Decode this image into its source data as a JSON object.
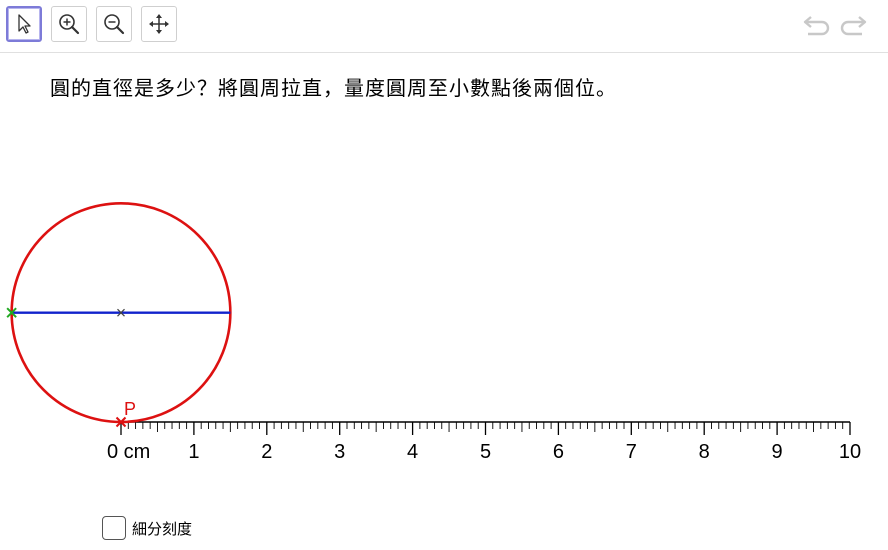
{
  "toolbar": {
    "tools": [
      {
        "name": "move-tool",
        "icon": "cursor-arrow-icon",
        "active": true
      },
      {
        "name": "zoom-in-tool",
        "icon": "zoom-in-icon",
        "active": false
      },
      {
        "name": "zoom-out-tool",
        "icon": "zoom-out-icon",
        "active": false
      },
      {
        "name": "move-graphics-view-tool",
        "icon": "move-arrows-icon",
        "active": false
      }
    ],
    "undo_icon": "undo-icon",
    "redo_icon": "redo-icon"
  },
  "question": "圓的直徑是多少？將圓周拉直，量度圓周至小數點後兩個位。",
  "construction": {
    "diameter_cm": 3,
    "point_label": "P",
    "colors": {
      "circle": "#dd1111",
      "diameter": "#1122cc",
      "left_point": "#22aa22",
      "center": "#444444",
      "point_p": "#dd1111"
    }
  },
  "ruler": {
    "unit": "cm",
    "min": 0,
    "max": 10,
    "labels": [
      "0 cm",
      "1",
      "2",
      "3",
      "4",
      "5",
      "6",
      "7",
      "8",
      "9",
      "10"
    ],
    "minor_per_major": 10
  },
  "subdivide": {
    "label": "細分刻度",
    "checked": false
  }
}
